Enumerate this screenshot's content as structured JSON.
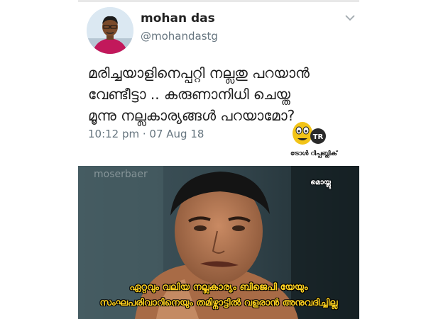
{
  "tweet": {
    "name": "mohan das",
    "handle": "@mohandastg",
    "text_lines": [
      "മരിച്ചയാളിനെപ്പറ്റി നല്ലതു പറയാൻ",
      "വേണ്ടീട്ടാ .. കരുണാനിധി ചെയ്ത",
      "മൂന്നു നല്ലകാര്യങ്ങൾ പറയാമോ?"
    ],
    "timestamp": "10:12 pm · 07 Aug 18",
    "icons": {
      "avatar": "profile-photo",
      "caret": "chevron-down-icon"
    }
  },
  "brand": {
    "logo_text": "TR",
    "label": "ട്രോൾ റിപ്പബ്ലിക്",
    "colors": {
      "yellow": "#f2c418",
      "dark": "#2a2a2a"
    }
  },
  "meme": {
    "watermark": "moserbaer",
    "corner_label": "മൊയ്ലു",
    "caption_lines": [
      "ഏറ്റവും വലിയ നല്ലകാര്യം ബിജെപി യേയും",
      "സംഘപരിവാറിനെയും തമിഴ്നാട്ടിൽ വളരാൻ അനുവദിച്ചില്ല"
    ],
    "caption_color": "#ffd21f"
  }
}
